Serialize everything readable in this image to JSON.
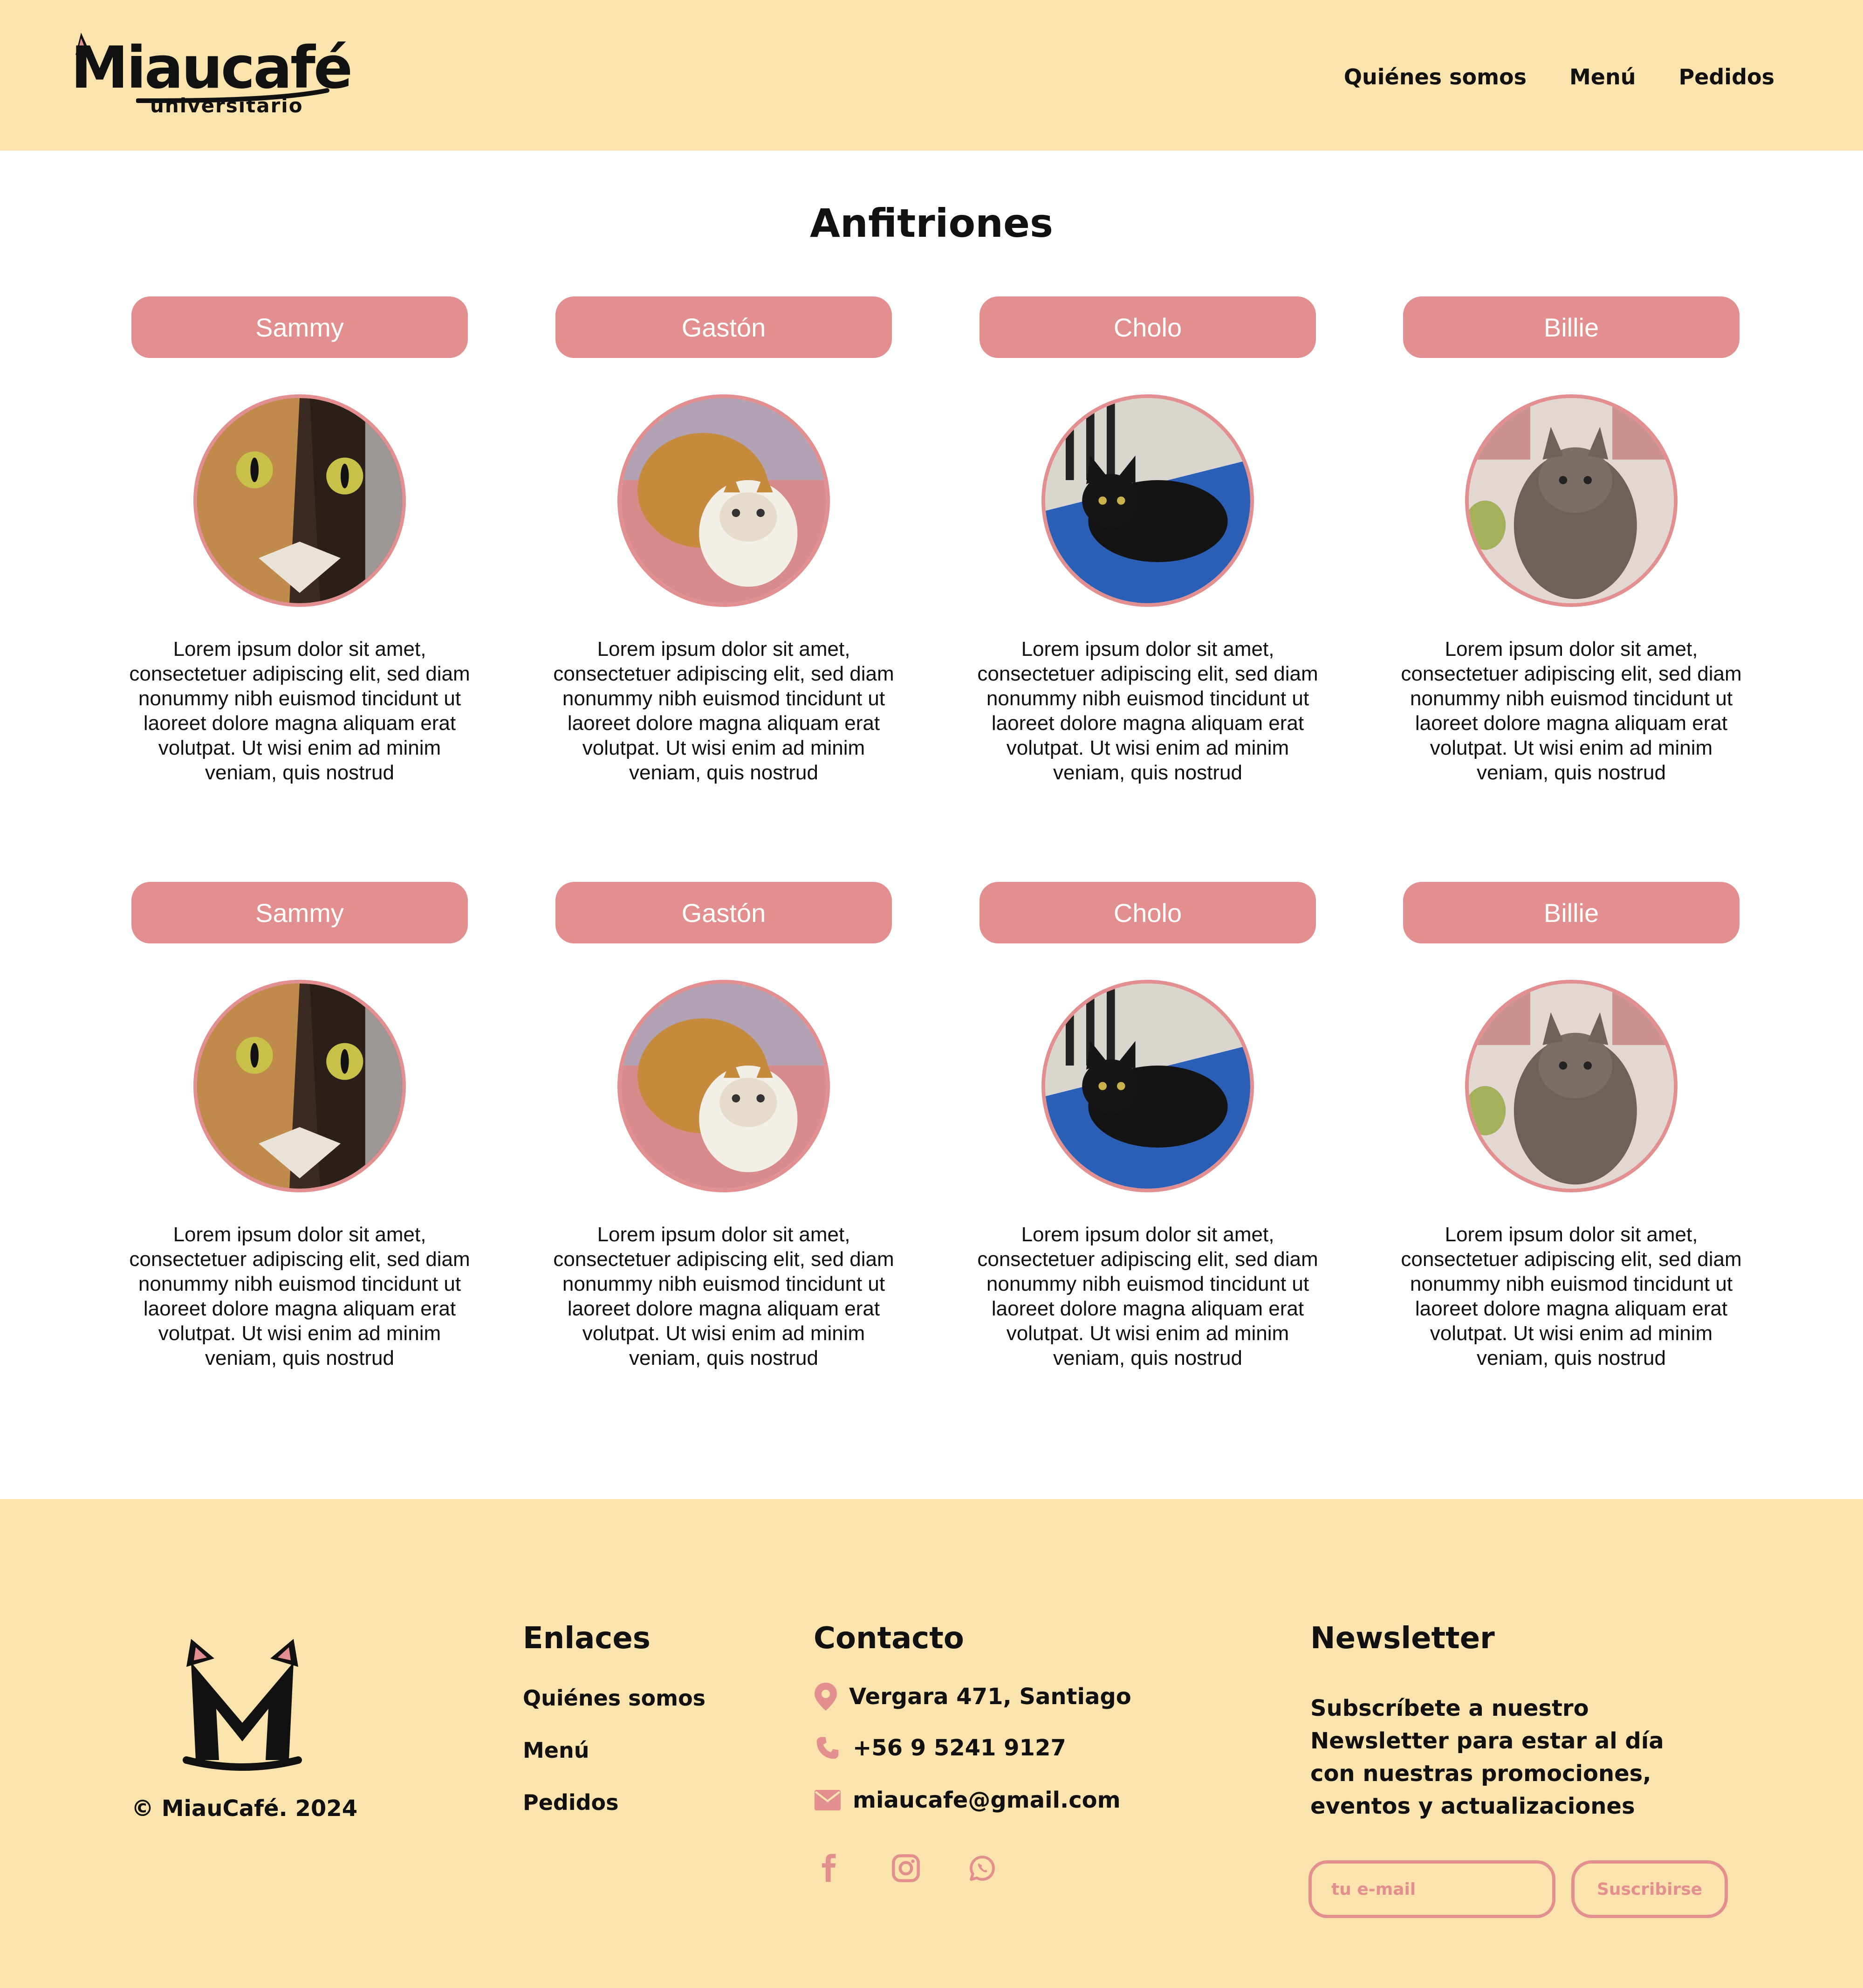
{
  "header": {
    "logo_text": "Miaucafé",
    "logo_sub": "universitario",
    "nav": [
      "Quiénes somos",
      "Menú",
      "Pedidos"
    ]
  },
  "main": {
    "title": "Anfitriones",
    "cards": [
      {
        "name": "Sammy",
        "desc": "Lorem ipsum dolor sit amet, consectetuer adipiscing elit, sed diam nonummy nibh euismod tincidunt ut laoreet dolore magna aliquam erat volutpat. Ut wisi enim ad minim veniam, quis nostrud"
      },
      {
        "name": "Gastón",
        "desc": "Lorem ipsum dolor sit amet, consectetuer adipiscing elit, sed diam nonummy nibh euismod tincidunt ut laoreet dolore magna aliquam erat volutpat. Ut wisi enim ad minim veniam, quis nostrud"
      },
      {
        "name": "Cholo",
        "desc": "Lorem ipsum dolor sit amet, consectetuer adipiscing elit, sed diam nonummy nibh euismod tincidunt ut laoreet dolore magna aliquam erat volutpat. Ut wisi enim ad minim veniam, quis nostrud"
      },
      {
        "name": "Billie",
        "desc": "Lorem ipsum dolor sit amet, consectetuer adipiscing elit, sed diam nonummy nibh euismod tincidunt ut laoreet dolore magna aliquam erat volutpat. Ut wisi enim ad minim veniam, quis nostrud"
      },
      {
        "name": "Sammy",
        "desc": "Lorem ipsum dolor sit amet, consectetuer adipiscing elit, sed diam nonummy nibh euismod tincidunt ut laoreet dolore magna aliquam erat volutpat. Ut wisi enim ad minim veniam, quis nostrud"
      },
      {
        "name": "Gastón",
        "desc": "Lorem ipsum dolor sit amet, consectetuer adipiscing elit, sed diam nonummy nibh euismod tincidunt ut laoreet dolore magna aliquam erat volutpat. Ut wisi enim ad minim veniam, quis nostrud"
      },
      {
        "name": "Cholo",
        "desc": "Lorem ipsum dolor sit amet, consectetuer adipiscing elit, sed diam nonummy nibh euismod tincidunt ut laoreet dolore magna aliquam erat volutpat. Ut wisi enim ad minim veniam, quis nostrud"
      },
      {
        "name": "Billie",
        "desc": "Lorem ipsum dolor sit amet, consectetuer adipiscing elit, sed diam nonummy nibh euismod tincidunt ut laoreet dolore magna aliquam erat volutpat. Ut wisi enim ad minim veniam, quis nostrud"
      }
    ]
  },
  "footer": {
    "copyright": "© MiauCafé. 2024",
    "links_title": "Enlaces",
    "links": [
      "Quiénes somos",
      "Menú",
      "Pedidos"
    ],
    "contact_title": "Contacto",
    "address": "Vergara 471, Santiago",
    "phone": "+56 9 5241 9127",
    "email": "miaucafe@gmail.com",
    "social_icons": [
      "facebook-icon",
      "instagram-icon",
      "whatsapp-icon"
    ],
    "newsletter_title": "Newsletter",
    "newsletter_text": "Subscríbete a nuestro Newsletter para estar al día con nuestras promociones, eventos y actualizaciones",
    "email_placeholder": "tu e-mail",
    "subscribe_label": "Suscribirse"
  },
  "colors": {
    "accent": "#E48F8F",
    "header_bg": "#FAE3AC",
    "footer_bg": "#FAE3AC"
  }
}
